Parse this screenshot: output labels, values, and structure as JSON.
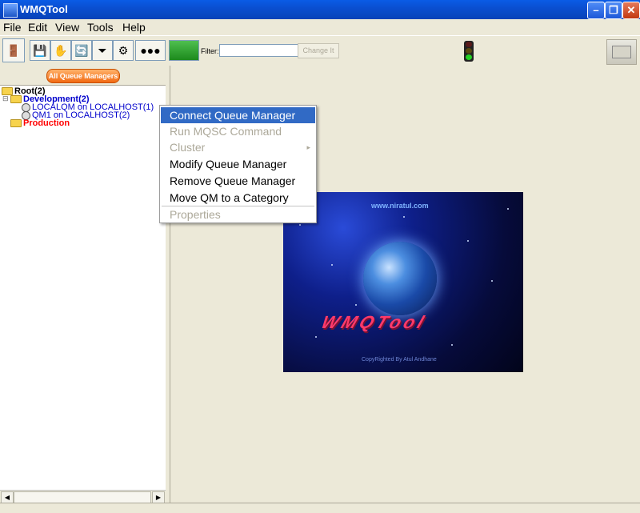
{
  "window": {
    "title": "WMQTool"
  },
  "menubar": {
    "items": [
      "File",
      "Edit",
      "View",
      "Tools",
      "Help"
    ]
  },
  "toolbar": {
    "filter_label": "Filter:",
    "filter_value": "",
    "change_button": "Change It"
  },
  "left_pane": {
    "all_qm_button": "All Queue Managers",
    "tree": {
      "root": "Root(2)",
      "development": "Development(2)",
      "qm1": "LOCALQM on LOCALHOST(1)",
      "qm2": "QM1 on LOCALHOST(2)",
      "production": "Production"
    }
  },
  "context_menu": {
    "items": [
      {
        "label": "Connect Queue Manager",
        "state": "selected"
      },
      {
        "label": "Run MQSC Command",
        "state": "disabled"
      },
      {
        "label": "Cluster",
        "state": "disabled",
        "submenu": true
      },
      {
        "label": "Modify Queue Manager",
        "state": "enabled"
      },
      {
        "label": "Remove Queue Manager",
        "state": "enabled"
      },
      {
        "label": "Move QM to a Category",
        "state": "enabled"
      },
      {
        "label": "Properties",
        "state": "disabled"
      }
    ]
  },
  "splash": {
    "url": "www.niratul.com",
    "banner": "WMQTool",
    "copyright": "CopyRighted By Atul Andhane"
  },
  "colors": {
    "titlebar": "#0a5ce6",
    "menu_highlight": "#316ac5",
    "dev_folder_text": "#0000cc",
    "production_text": "#ff0000",
    "qm_text": "#0000cc"
  }
}
